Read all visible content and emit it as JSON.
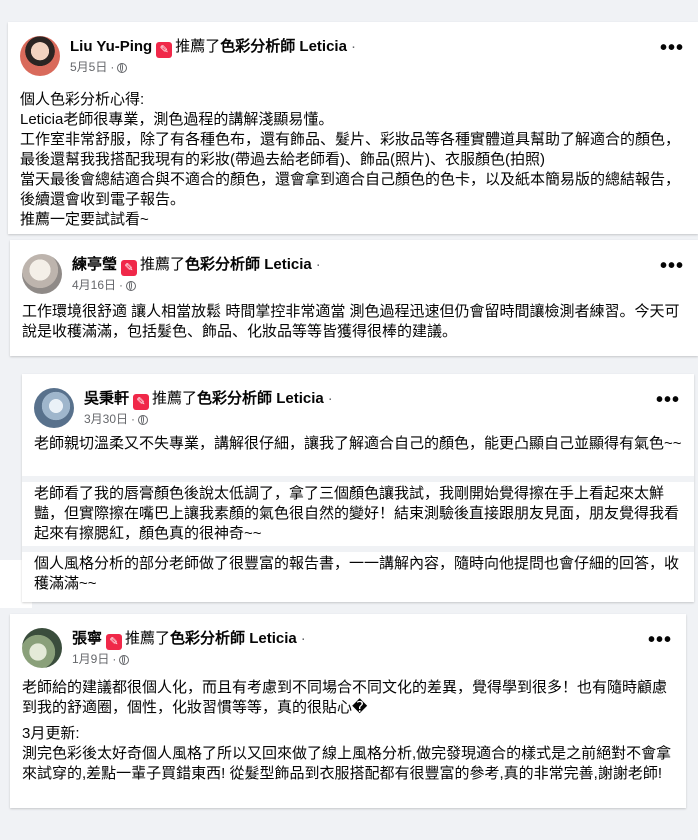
{
  "ui": {
    "more_glyph": "•••",
    "dot_glyph": "·",
    "recommend_glyph": "✎"
  },
  "posts": [
    {
      "author": "Liu Yu-Ping",
      "action": "推薦了",
      "page": "色彩分析師 Leticia",
      "date": "5月5日",
      "paragraphs": [
        "個人色彩分析心得:",
        "Leticia老師很專業，測色過程的講解淺顯易懂。",
        "工作室非常舒服，除了有各種色布，還有飾品、髮片、彩妝品等各種實體道具幫助了解適合的顏色，最後還幫我我搭配我現有的彩妝(帶過去給老師看)、飾品(照片)、衣服顏色(拍照)",
        "當天最後會總結適合與不適合的顏色，還會拿到適合自己顏色的色卡，以及紙本簡易版的總結報告，後續還會收到電子報告。",
        "推薦一定要試試看~"
      ]
    },
    {
      "author": "練亭瑩",
      "action": "推薦了",
      "page": "色彩分析師 Leticia",
      "date": "4月16日",
      "paragraphs": [
        "工作環境很舒適 讓人相當放鬆 時間掌控非常適當 測色過程迅速但仍會留時間讓檢測者練習。今天可說是收穫滿滿，包括髮色、飾品、化妝品等等皆獲得很棒的建議。"
      ]
    },
    {
      "author": "吳秉軒",
      "action": "推薦了",
      "page": "色彩分析師 Leticia",
      "date": "3月30日",
      "paragraphs": [
        "老師親切溫柔又不失專業，講解很仔細，讓我了解適合自己的顏色，能更凸顯自己並顯得有氣色~~",
        "老師看了我的唇膏顏色後說太低調了，拿了三個顏色讓我試，我剛開始覺得擦在手上看起來太鮮豔，但實際擦在嘴巴上讓我素顏的氣色很自然的變好！結束測驗後直接跟朋友見面，朋友覺得我看起來有擦腮紅，顏色真的很神奇~~",
        "個人風格分析的部分老師做了很豐富的報告書，一一講解內容，隨時向他提問也會仔細的回答，收穫滿滿~~"
      ]
    },
    {
      "author": "張寧",
      "action": "推薦了",
      "page": "色彩分析師 Leticia",
      "date": "1月9日",
      "paragraphs": [
        "老師給的建議都很個人化，而且有考慮到不同場合不同文化的差異，覺得學到很多！也有隨時顧慮到我的舒適圈，個性，化妝習慣等等，真的很貼心�",
        "3月更新:",
        "測完色彩後太好奇個人風格了所以又回來做了線上風格分析,做完發現適合的樣式是之前絕對不會拿來試穿的,差點一輩子買錯東西! 從髮型飾品到衣服搭配都有很豐富的參考,真的非常完善,謝謝老師!"
      ]
    }
  ]
}
